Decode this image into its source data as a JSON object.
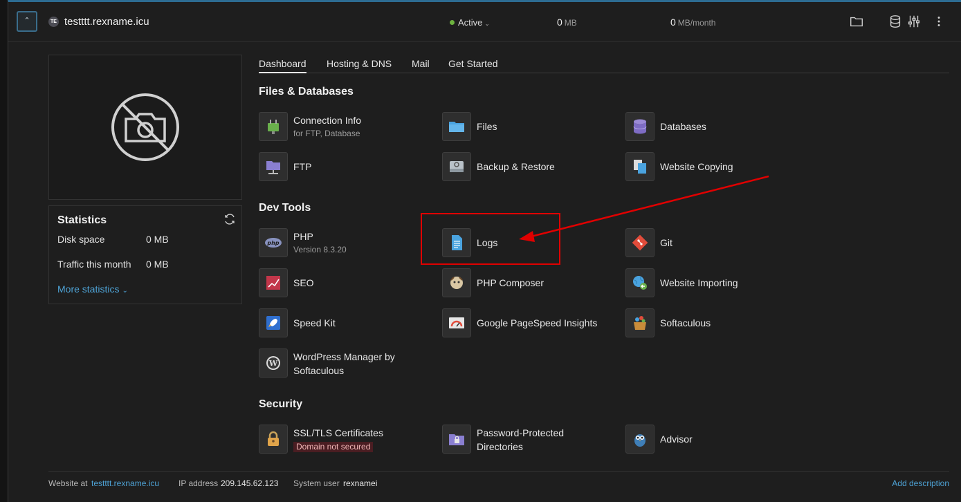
{
  "site": {
    "favicon_text": "TE",
    "name": "testttt.rexname.icu"
  },
  "status": {
    "label": "Active"
  },
  "metrics": [
    {
      "value": "0",
      "unit": "MB"
    },
    {
      "value": "0",
      "unit": "MB/month"
    }
  ],
  "toolbar_icons": [
    "folder-icon",
    "database-icon",
    "sliders-icon",
    "more-vertical-icon"
  ],
  "stats": {
    "title": "Statistics",
    "disk_label": "Disk space",
    "disk_value": "0 MB",
    "traffic_label": "Traffic this month",
    "traffic_value": "0 MB",
    "more_label": "More statistics"
  },
  "tabs": [
    "Dashboard",
    "Hosting & DNS",
    "Mail",
    "Get Started"
  ],
  "sections": {
    "files": "Files & Databases",
    "dev": "Dev Tools",
    "security": "Security"
  },
  "tools": {
    "connection": {
      "label": "Connection Info",
      "sub": "for FTP, Database"
    },
    "files": {
      "label": "Files"
    },
    "databases": {
      "label": "Databases"
    },
    "ftp": {
      "label": "FTP"
    },
    "backup": {
      "label": "Backup & Restore"
    },
    "copying": {
      "label": "Website Copying"
    },
    "php": {
      "label": "PHP",
      "sub": "Version 8.3.20"
    },
    "logs": {
      "label": "Logs"
    },
    "git": {
      "label": "Git"
    },
    "seo": {
      "label": "SEO"
    },
    "composer": {
      "label": "PHP Composer"
    },
    "importing": {
      "label": "Website Importing"
    },
    "speedkit": {
      "label": "Speed Kit"
    },
    "pagespeed": {
      "label": "Google PageSpeed Insights"
    },
    "softaculous": {
      "label": "Softaculous"
    },
    "wpmanager": {
      "label1": "WordPress Manager by",
      "label2": "Softaculous"
    },
    "ssl": {
      "label": "SSL/TLS Certificates",
      "warn": "Domain not secured"
    },
    "pwdirs": {
      "label1": "Password-Protected",
      "label2": "Directories"
    },
    "advisor": {
      "label": "Advisor"
    }
  },
  "footer": {
    "website_at": "Website at",
    "website_link": "testttt.rexname.icu",
    "ip_label": "IP address",
    "ip_value": "209.145.62.123",
    "user_label": "System user",
    "user_value": "rexnamei",
    "add_description": "Add description"
  },
  "colors": {
    "accent": "#4ea3d6",
    "active": "#6db33f",
    "annotation": "#e00000"
  }
}
